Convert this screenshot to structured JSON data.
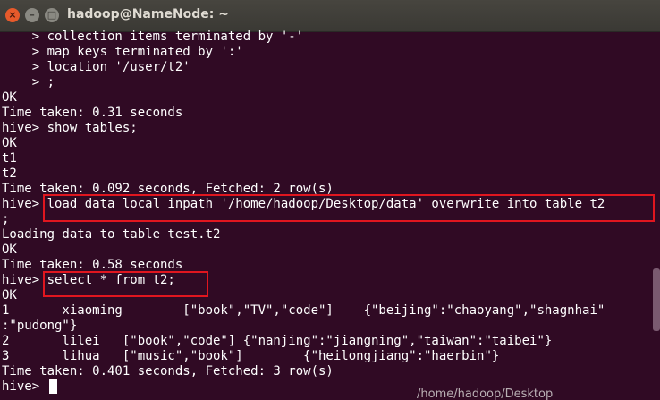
{
  "window": {
    "title": "hadoop@NameNode: ~",
    "close_glyph": "×",
    "min_glyph": "–",
    "max_glyph": "□"
  },
  "terminal": {
    "lines": [
      "    > collection items terminated by '-'",
      "    > map keys terminated by ':'",
      "    > location '/user/t2'",
      "    > ;",
      "OK",
      "Time taken: 0.31 seconds",
      "hive> show tables;",
      "OK",
      "t1",
      "t2",
      "Time taken: 0.092 seconds, Fetched: 2 row(s)",
      "hive> load data local inpath '/home/hadoop/Desktop/data' overwrite into table t2",
      ";",
      "Loading data to table test.t2",
      "OK",
      "Time taken: 0.58 seconds",
      "hive> select * from t2;",
      "OK",
      "1       xiaoming        [\"book\",\"TV\",\"code\"]    {\"beijing\":\"chaoyang\",\"shagnhai\"",
      ":\"pudong\"}",
      "2       lilei   [\"book\",\"code\"] {\"nanjing\":\"jiangning\",\"taiwan\":\"taibei\"}",
      "3       lihua   [\"music\",\"book\"]        {\"heilongjiang\":\"haerbin\"}",
      "Time taken: 0.401 seconds, Fetched: 3 row(s)",
      "hive> "
    ]
  },
  "background_text": "/home/hadoop/Desktop"
}
